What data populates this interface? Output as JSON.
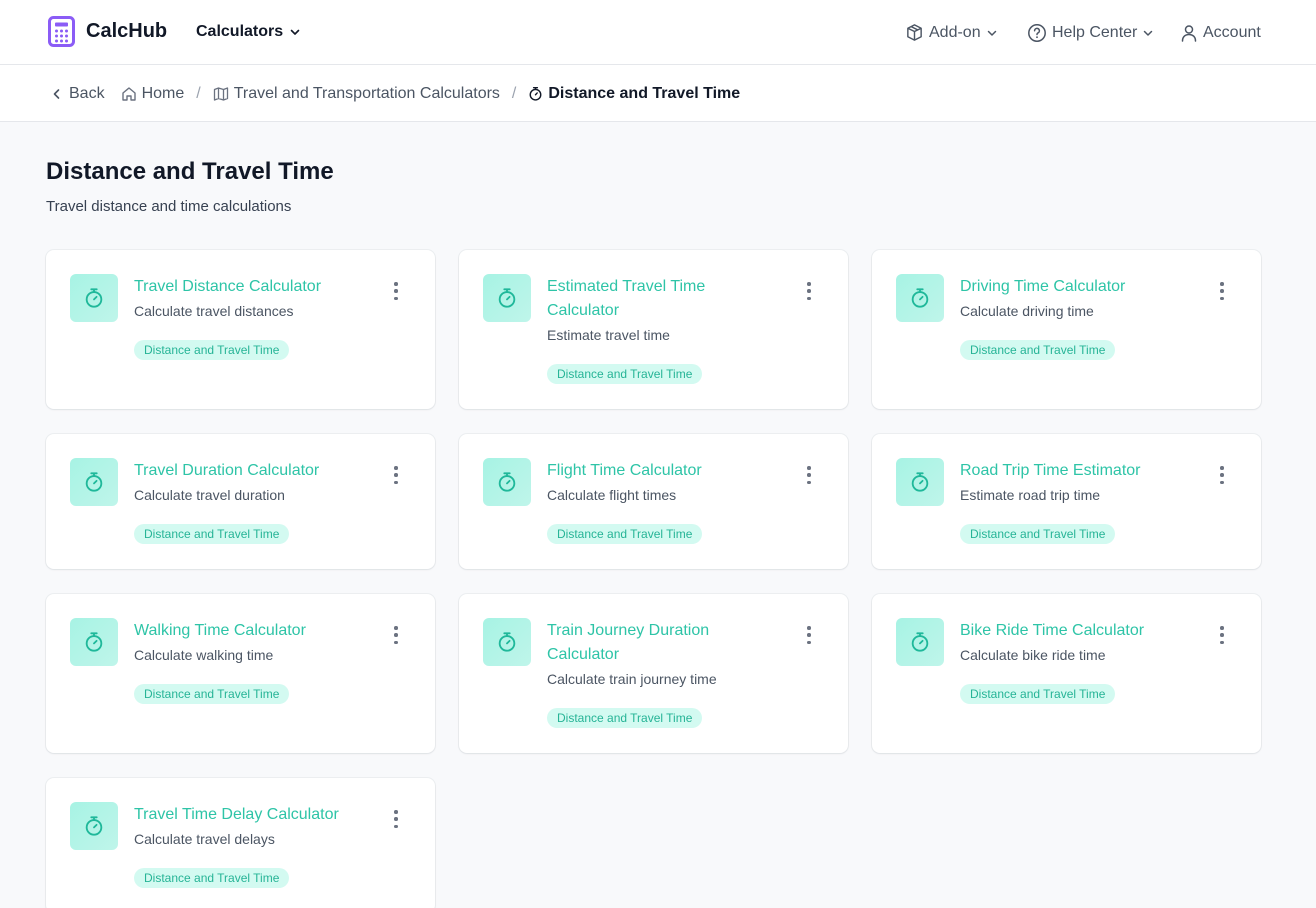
{
  "header": {
    "brand": "CalcHub",
    "calculators_label": "Calculators",
    "addon_label": "Add-on",
    "help_label": "Help Center",
    "account_label": "Account"
  },
  "breadcrumb": {
    "back": "Back",
    "home": "Home",
    "category": "Travel and Transportation Calculators",
    "current": "Distance and Travel Time"
  },
  "page": {
    "title": "Distance and Travel Time",
    "subtitle": "Travel distance and time calculations"
  },
  "cards": [
    {
      "title": "Travel Distance Calculator",
      "description": "Calculate travel distances",
      "tag": "Distance and Travel Time"
    },
    {
      "title": "Estimated Travel Time Calculator",
      "description": "Estimate travel time",
      "tag": "Distance and Travel Time"
    },
    {
      "title": "Driving Time Calculator",
      "description": "Calculate driving time",
      "tag": "Distance and Travel Time"
    },
    {
      "title": "Travel Duration Calculator",
      "description": "Calculate travel duration",
      "tag": "Distance and Travel Time"
    },
    {
      "title": "Flight Time Calculator",
      "description": "Calculate flight times",
      "tag": "Distance and Travel Time"
    },
    {
      "title": "Road Trip Time Estimator",
      "description": "Estimate road trip time",
      "tag": "Distance and Travel Time"
    },
    {
      "title": "Walking Time Calculator",
      "description": "Calculate walking time",
      "tag": "Distance and Travel Time"
    },
    {
      "title": "Train Journey Duration Calculator",
      "description": "Calculate train journey time",
      "tag": "Distance and Travel Time"
    },
    {
      "title": "Bike Ride Time Calculator",
      "description": "Calculate bike ride time",
      "tag": "Distance and Travel Time"
    },
    {
      "title": "Travel Time Delay Calculator",
      "description": "Calculate travel delays",
      "tag": "Distance and Travel Time"
    }
  ],
  "colors": {
    "brand_purple": "#8b5cf6",
    "accent_teal": "#2ec4a7",
    "tag_bg": "#d3faf1"
  },
  "icons": {
    "logo": "calculator-icon",
    "card": "stopwatch-icon"
  }
}
